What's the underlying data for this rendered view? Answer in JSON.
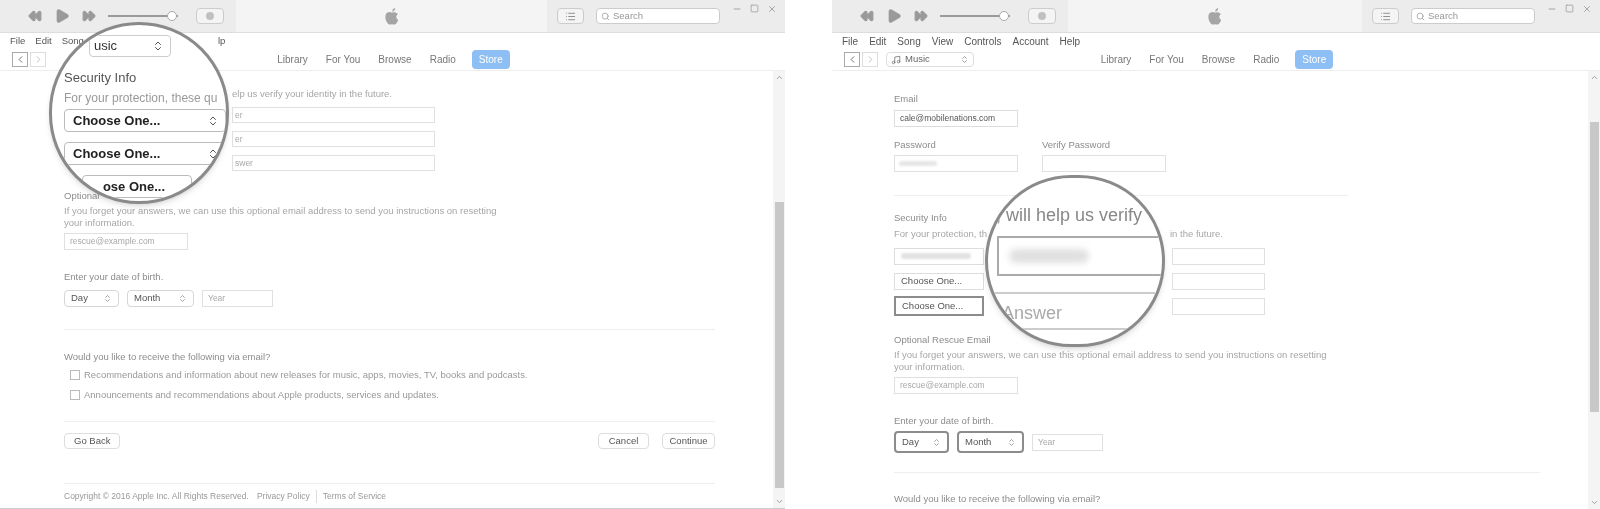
{
  "left_window": {
    "volume": {
      "level": 0.92
    },
    "search_placeholder": "Search",
    "menu": [
      "File",
      "Edit",
      "Song"
    ],
    "menu_fragment": "lp",
    "tabs": [
      {
        "label": "Library",
        "selected": false
      },
      {
        "label": "For You",
        "selected": false
      },
      {
        "label": "Browse",
        "selected": false
      },
      {
        "label": "Radio",
        "selected": false
      },
      {
        "label": "Store",
        "selected": true
      }
    ],
    "magnifier": {
      "library_select": "usic",
      "title": "Security Info",
      "description": "For your protection, these qu",
      "selects": [
        "Choose One...",
        "Choose One...",
        "ose One..."
      ]
    },
    "security": {
      "description": "elp us verify your identity in the future.",
      "answer_fields": [
        {
          "placeholder": "er"
        },
        {
          "placeholder": "er"
        },
        {
          "placeholder": "swer"
        }
      ]
    },
    "rescue": {
      "title": "Optional",
      "description": "If you forget your answers, we can use this optional email address to send you instructions on resetting your information.",
      "placeholder": "rescue@example.com"
    },
    "birth": {
      "label": "Enter your date of birth.",
      "selects": [
        {
          "value": "Day",
          "highlighted": false
        },
        {
          "value": "Month",
          "highlighted": false
        }
      ],
      "year_placeholder": "Year"
    },
    "email_prefs": {
      "question": "Would you like to receive the following via email?",
      "options": [
        {
          "label": "Recommendations and information about new releases for music, apps, movies, TV, books and podcasts.",
          "checked": false
        },
        {
          "label": "Announcements and recommendations about Apple products, services and updates.",
          "checked": false
        }
      ]
    },
    "buttons": {
      "back": "Go Back",
      "cancel": "Cancel",
      "continue": "Continue"
    },
    "footer": {
      "copyright": "Copyright © 2016 Apple Inc. All Rights Reserved.",
      "links": [
        "Privacy Policy",
        "Terms of Service"
      ]
    }
  },
  "right_window": {
    "volume": {
      "level": 0.92
    },
    "search_placeholder": "Search",
    "menu": [
      "File",
      "Edit",
      "Song",
      "View",
      "Controls",
      "Account",
      "Help"
    ],
    "library_select": "Music",
    "tabs": [
      {
        "label": "Library",
        "selected": false
      },
      {
        "label": "For You",
        "selected": false
      },
      {
        "label": "Browse",
        "selected": false
      },
      {
        "label": "Radio",
        "selected": false
      },
      {
        "label": "Store",
        "selected": true
      }
    ],
    "email": {
      "label": "Email",
      "value": "cale@mobilenations.com"
    },
    "password": {
      "label": "Password"
    },
    "verify_password": {
      "label": "Verify Password"
    },
    "security": {
      "title": "Security Info",
      "description_start": "For your protection, th",
      "description_end": "in the future.",
      "selects": [
        {
          "kind": "blurred",
          "highlighted": false
        },
        {
          "kind": "text",
          "value": "Choose One...",
          "highlighted": false
        },
        {
          "kind": "text",
          "value": "Choose One...",
          "highlighted": true
        }
      ]
    },
    "magnifier": {
      "caption": ", will help us verify",
      "answer_placeholder": "Answer"
    },
    "rescue": {
      "title": "Optional Rescue Email",
      "description": "If you forget your answers, we can use this optional email address to send you instructions on resetting your information.",
      "placeholder": "rescue@example.com"
    },
    "birth": {
      "label": "Enter your date of birth.",
      "selects": [
        {
          "value": "Day",
          "highlighted": true
        },
        {
          "value": "Month",
          "highlighted": true
        }
      ],
      "year_placeholder": "Year"
    },
    "email_prefs": {
      "question": "Would you like to receive the following via email?"
    }
  }
}
